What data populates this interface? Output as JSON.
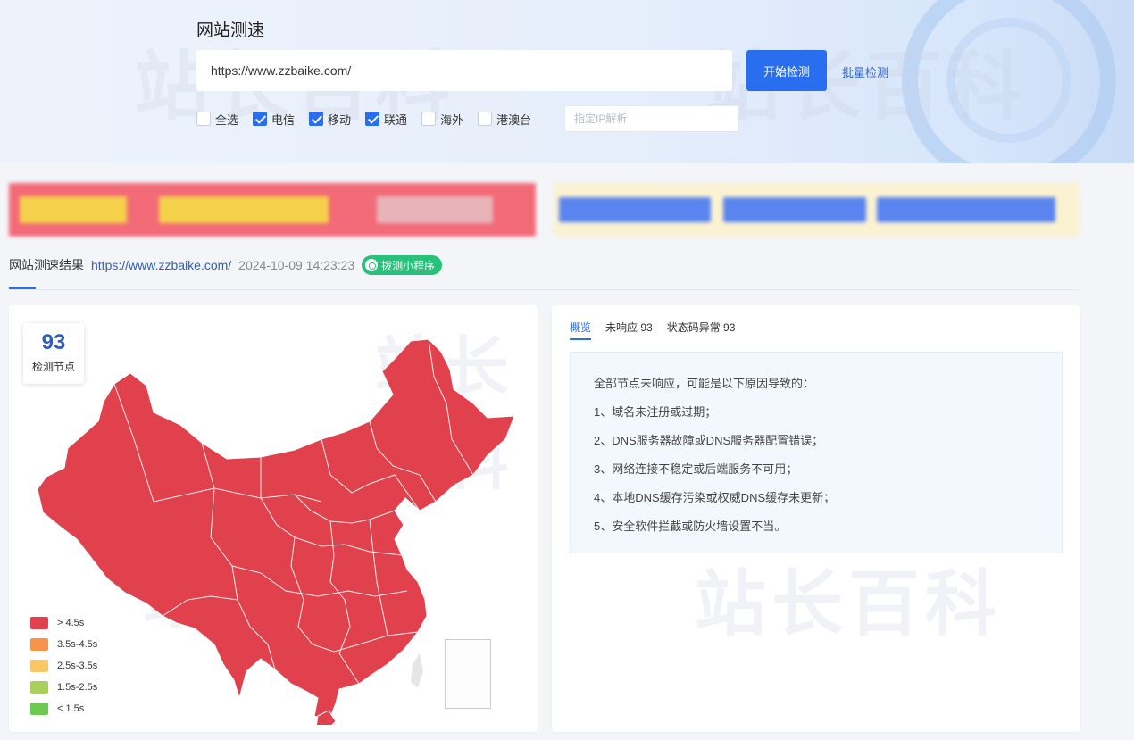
{
  "header": {
    "title": "网站测速",
    "url_value": "https://www.zzbaike.com/",
    "start_button": "开始检测",
    "batch_link": "批量检测",
    "ip_placeholder": "指定IP解析",
    "checkboxes": [
      {
        "label": "全选",
        "checked": false
      },
      {
        "label": "电信",
        "checked": true
      },
      {
        "label": "移动",
        "checked": true
      },
      {
        "label": "联通",
        "checked": true
      },
      {
        "label": "海外",
        "checked": false
      },
      {
        "label": "港澳台",
        "checked": false
      }
    ]
  },
  "watermark": "站长百科",
  "result": {
    "title": "网站测速结果",
    "url": "https://www.zzbaike.com/",
    "time": "2024-10-09 14:23:23",
    "badge": "拨测小程序"
  },
  "map": {
    "node_count": "93",
    "node_label": "检测节点",
    "fill_color": "#e0414d",
    "legend": [
      {
        "label": "> 4.5s",
        "color": "#e0414d"
      },
      {
        "label": "3.5s-4.5s",
        "color": "#f7944a"
      },
      {
        "label": "2.5s-3.5s",
        "color": "#f9c766"
      },
      {
        "label": "1.5s-2.5s",
        "color": "#a9d05a"
      },
      {
        "label": "< 1.5s",
        "color": "#6dc94f"
      }
    ]
  },
  "info": {
    "tabs": [
      "概览",
      "未响应 93",
      "状态码异常 93"
    ],
    "reasons": [
      "全部节点未响应，可能是以下原因导致的：",
      "1、域名未注册或过期；",
      "2、DNS服务器故障或DNS服务器配置错误；",
      "3、网络连接不稳定或后端服务不可用；",
      "4、本地DNS缓存污染或权威DNS缓存未更新；",
      "5、安全软件拦截或防火墙设置不当。"
    ]
  }
}
